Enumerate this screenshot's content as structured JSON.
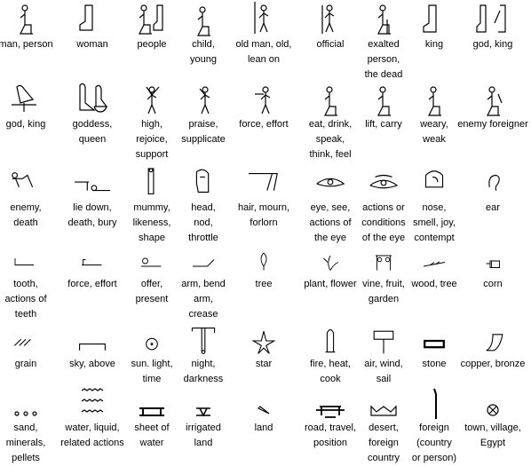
{
  "items": [
    {
      "icon": "seated-man-glyph",
      "label": "man, person"
    },
    {
      "icon": "seated-woman-glyph",
      "label": "woman"
    },
    {
      "icon": "man-and-woman-glyph",
      "label": "people"
    },
    {
      "icon": "child-glyph",
      "label": "child,\nyoung"
    },
    {
      "icon": "man-with-staff-glyph",
      "label": "old man, old,\nlean on"
    },
    {
      "icon": "official-glyph",
      "label": "official"
    },
    {
      "icon": "seated-on-chair-glyph",
      "label": "exalted\nperson,\nthe dead"
    },
    {
      "icon": "king-glyph",
      "label": "king"
    },
    {
      "icon": "god-king-figures-glyph",
      "label": "god, king"
    },
    {
      "icon": "falcon-on-standard-glyph",
      "label": "god, king"
    },
    {
      "icon": "goddess-glyph",
      "label": "goddess,\nqueen"
    },
    {
      "icon": "arms-raised-glyph",
      "label": "high,\nrejoice,\nsupport"
    },
    {
      "icon": "praising-man-glyph",
      "label": "praise,\nsupplicate"
    },
    {
      "icon": "man-with-stick-glyph",
      "label": "force, effort"
    },
    {
      "icon": "hand-to-mouth-glyph",
      "label": "eat, drink,\nspeak,\nthink, feel"
    },
    {
      "icon": "lifting-man-glyph",
      "label": "lift, carry"
    },
    {
      "icon": "weary-man-glyph",
      "label": "weary,\nweak"
    },
    {
      "icon": "bound-captive-glyph",
      "label": "enemy foreigner"
    },
    {
      "icon": "fallen-man-glyph",
      "label": "enemy,\ndeath"
    },
    {
      "icon": "bier-glyph",
      "label": "lie down,\ndeath, bury"
    },
    {
      "icon": "mummy-glyph",
      "label": "mummy,\nlikeness,\nshape"
    },
    {
      "icon": "head-glyph",
      "label": "head,\nnod,\nthrottle"
    },
    {
      "icon": "hair-glyph",
      "label": "hair, mourn,\nforlorn"
    },
    {
      "icon": "eye-glyph",
      "label": "eye, see,\nactions of\nthe eye"
    },
    {
      "icon": "eye-paint-glyph",
      "label": "actions or\nconditions\nof the eye"
    },
    {
      "icon": "nose-glyph",
      "label": "nose,\nsmell, joy,\ncontempt"
    },
    {
      "icon": "ear-glyph",
      "label": "ear"
    },
    {
      "icon": "tooth-glyph",
      "label": "tooth,\nactions of\nteeth"
    },
    {
      "icon": "arm-with-stick-glyph",
      "label": "force, effort"
    },
    {
      "icon": "arm-offering-glyph",
      "label": "offer,\npresent"
    },
    {
      "icon": "bent-arm-glyph",
      "label": "arm, bend\narm,\ncrease"
    },
    {
      "icon": "tree-glyph",
      "label": "tree"
    },
    {
      "icon": "plant-glyph",
      "label": "plant, flower"
    },
    {
      "icon": "vine-glyph",
      "label": "vine, fruit,\ngarden"
    },
    {
      "icon": "branch-glyph",
      "label": "wood, tree"
    },
    {
      "icon": "corn-glyph",
      "label": "corn"
    },
    {
      "icon": "grains-glyph",
      "label": "grain"
    },
    {
      "icon": "sky-glyph",
      "label": "sky, above"
    },
    {
      "icon": "sun-glyph",
      "label": "sun. light,\ntime"
    },
    {
      "icon": "night-sky-glyph",
      "label": "night,\ndarkness"
    },
    {
      "icon": "star-glyph",
      "label": "star"
    },
    {
      "icon": "brazier-glyph",
      "label": "fire, heat,\ncook"
    },
    {
      "icon": "sail-glyph",
      "label": "air, wind,\nsail"
    },
    {
      "icon": "stone-glyph",
      "label": "stone"
    },
    {
      "icon": "copper-glyph",
      "label": "copper, bronze"
    },
    {
      "icon": "sand-grains-glyph",
      "label": "sand,\nminerals,\npellets"
    },
    {
      "icon": "water-glyph",
      "label": "water, liquid,\nrelated actions"
    },
    {
      "icon": "pool-glyph",
      "label": "sheet of\nwater"
    },
    {
      "icon": "irrigated-land-glyph",
      "label": "irrigated\nland"
    },
    {
      "icon": "land-glyph",
      "label": "land"
    },
    {
      "icon": "road-glyph",
      "label": "road, travel,\nposition"
    },
    {
      "icon": "desert-hills-glyph",
      "label": "desert,\nforeign\ncountry"
    },
    {
      "icon": "throwstick-glyph",
      "label": "foreign\n(country\nor person)"
    },
    {
      "icon": "town-glyph",
      "label": "town, village,\nEgypt"
    }
  ]
}
